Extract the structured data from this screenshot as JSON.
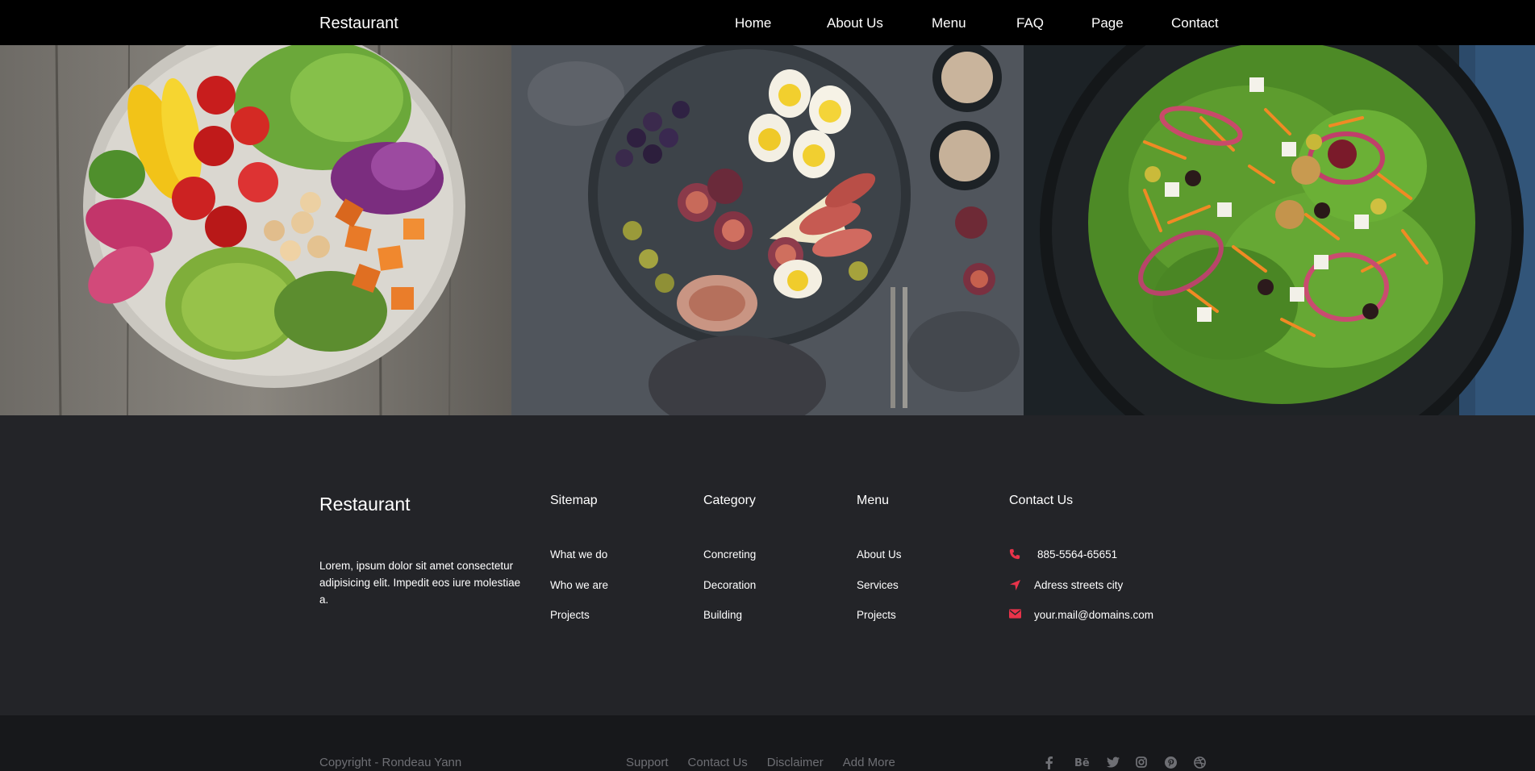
{
  "navbar": {
    "brand": "Restaurant",
    "items": [
      {
        "label": "Home"
      },
      {
        "label": "About Us"
      },
      {
        "label": "Menu"
      },
      {
        "label": "FAQ"
      },
      {
        "label": "Page"
      },
      {
        "label": "Contact"
      }
    ]
  },
  "gallery": {
    "images": [
      {
        "name": "vegetable-bowl-photo"
      },
      {
        "name": "charcuterie-platter-photo"
      },
      {
        "name": "green-salad-photo"
      }
    ]
  },
  "footer": {
    "brand": "Restaurant",
    "about": "Lorem, ipsum dolor sit amet consectetur adipisicing elit. Impedit eos iure molestiae a.",
    "sitemap": {
      "title": "Sitemap",
      "links": [
        "What we do",
        "Who we are",
        "Projects"
      ]
    },
    "category": {
      "title": "Category",
      "links": [
        "Concreting",
        "Decoration",
        "Building"
      ]
    },
    "menu": {
      "title": "Menu",
      "links": [
        "About Us",
        "Services",
        "Projects"
      ]
    },
    "contact": {
      "title": "Contact Us",
      "phone": "885-5564-65651",
      "address": "Adress streets city",
      "email": "your.mail@domains.com",
      "icons": [
        "phone-icon",
        "location-arrow-icon",
        "envelope-icon"
      ]
    }
  },
  "bottom": {
    "copyright": "Copyright - Rondeau Yann",
    "links": [
      "Support",
      "Contact Us",
      "Disclaimer",
      "Add More"
    ],
    "socials": [
      "facebook-icon",
      "behance-icon",
      "twitter-icon",
      "instagram-icon",
      "pinterest-icon",
      "dribbble-icon"
    ]
  },
  "colors": {
    "navbar_bg": "#000000",
    "footer_bg": "#232428",
    "bottombar_bg": "#17181b",
    "accent": "#e8334a",
    "muted_text": "#6e6f74"
  }
}
